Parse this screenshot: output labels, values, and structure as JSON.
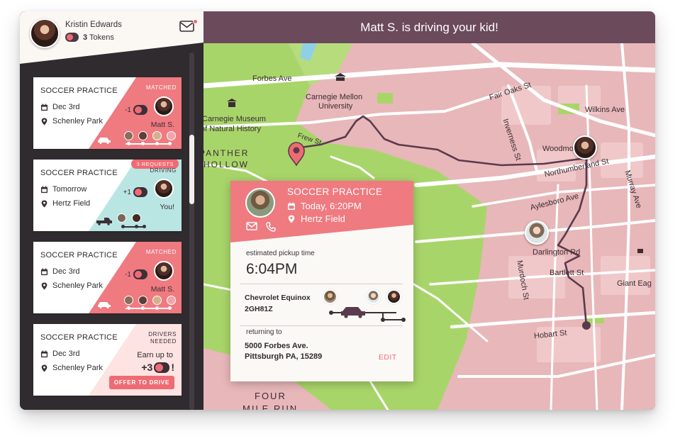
{
  "user": {
    "name": "Kristin Edwards",
    "tokens_count": "3",
    "tokens_label": "Tokens",
    "icon_mail": "mail-icon"
  },
  "colors": {
    "accent": "#ef6b73",
    "plum": "#6b4a5c",
    "teal": "#b9e6e3",
    "sidebar": "#2f2b2f",
    "map_pink": "#e8b7b9",
    "park_green": "#a8d56a"
  },
  "cards": [
    {
      "title": "SOCCER PRACTICE",
      "date": "Dec 3rd",
      "place": "Schenley Park",
      "status": "MATCHED",
      "token_change": "-1",
      "driver": "Matt S."
    },
    {
      "title": "SOCCER PRACTICE",
      "date": "Tomorrow",
      "place": "Hertz Field",
      "badge": "3 REQUESTS",
      "status": "DRIVING",
      "token_change": "+1",
      "driver": "You!"
    },
    {
      "title": "SOCCER PRACTICE",
      "date": "Dec 3rd",
      "place": "Schenley Park",
      "status": "MATCHED",
      "token_change": "-1",
      "driver": "Matt S."
    },
    {
      "title": "SOCCER PRACTICE",
      "date": "Dec 3rd",
      "place": "Schenley Park",
      "status_line1": "DRIVERS",
      "status_line2": "NEEDED",
      "earn_label": "Earn up to",
      "earn_value": "+3",
      "earn_suffix": "!",
      "button": "OFFER TO DRIVE"
    }
  ],
  "main": {
    "banner": "Matt S. is driving your kid!"
  },
  "popup": {
    "title": "SOCCER PRACTICE",
    "time": "Today, 6:20PM",
    "place": "Hertz Field",
    "pickup_label": "estimated pickup time",
    "pickup_time": "6:04PM",
    "car_model": "Chevrolet Equinox",
    "car_plate": "2GH81Z",
    "returning_label": "returning to",
    "address_line1": "5000 Forbes Ave.",
    "address_line2": "Pittsburgh PA, 15289",
    "edit": "EDIT"
  },
  "map_labels": {
    "forbes": "Forbes Ave",
    "cmu1": "Carnegie Mellon",
    "cmu2": "University",
    "museum1": "Carnegie Museum",
    "museum2": "of Natural History",
    "panther": "PANTHER",
    "hollow": "HOLLOW",
    "frew": "Frew St",
    "fair_oaks": "Fair Oaks St",
    "wilkins": "Wilkins Ave",
    "inverness": "Inverness St",
    "woodmont": "Woodmont St",
    "northumberland": "Northumberland St",
    "murray": "Murray Ave",
    "aylesboro": "Aylesboro Ave",
    "darlington": "Darlington Rd",
    "bartlett": "Bartlett St",
    "murdoch": "Murdoch St",
    "giant_eagle": "Giant Eag",
    "hobart": "Hobart St",
    "four": "FOUR",
    "mile_run": "MILE RUN"
  }
}
